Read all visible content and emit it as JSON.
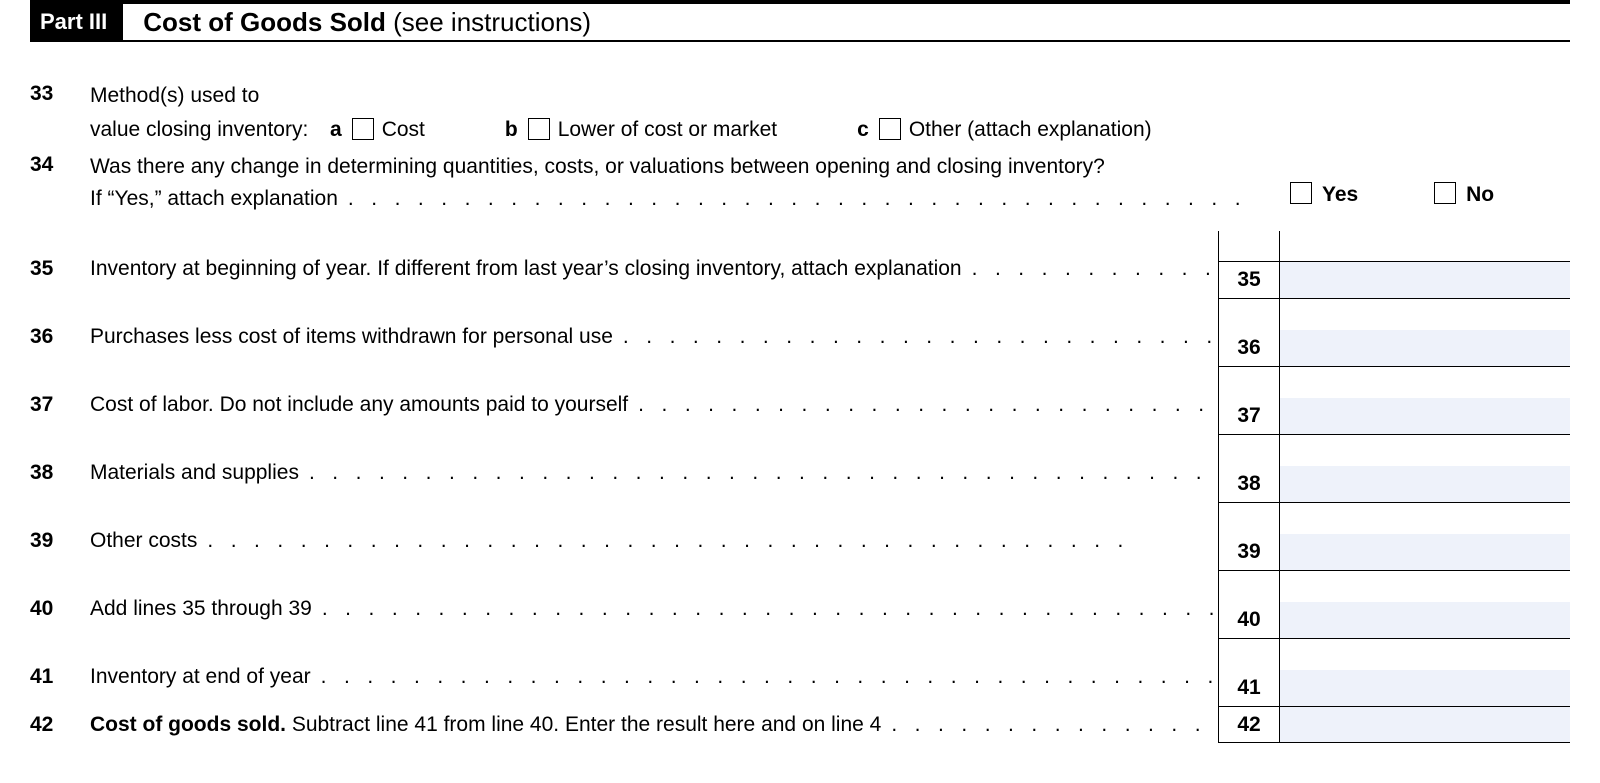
{
  "header": {
    "part": "Part III",
    "title_bold": "Cost of Goods Sold",
    "title_rest": " (see instructions)"
  },
  "line33": {
    "num": "33",
    "text1": "Method(s) used to",
    "text2": "value closing inventory:",
    "opts": {
      "a_label": "a",
      "a_text": "Cost",
      "b_label": "b",
      "b_text": "Lower of cost or market",
      "c_label": "c",
      "c_text": "Other (attach explanation)"
    }
  },
  "line34": {
    "num": "34",
    "text1": "Was there any change in determining quantities, costs, or valuations between opening and closing inventory?",
    "text2": "If “Yes,” attach explanation",
    "yes": "Yes",
    "no": "No"
  },
  "amount_lines": [
    {
      "num": "35",
      "box": "35",
      "text": "Inventory at beginning of year. If different from last year’s closing inventory, attach explanation",
      "bold": false,
      "value": ""
    },
    {
      "num": "36",
      "box": "36",
      "text": "Purchases less cost of items withdrawn for personal use",
      "bold": false,
      "value": ""
    },
    {
      "num": "37",
      "box": "37",
      "text": "Cost of labor. Do not include any amounts paid to yourself",
      "bold": false,
      "value": ""
    },
    {
      "num": "38",
      "box": "38",
      "text": "Materials and supplies",
      "bold": false,
      "value": ""
    },
    {
      "num": "39",
      "box": "39",
      "text": "Other costs",
      "bold": false,
      "value": ""
    },
    {
      "num": "40",
      "box": "40",
      "text": "Add lines 35 through 39",
      "bold": false,
      "value": ""
    },
    {
      "num": "41",
      "box": "41",
      "text": "Inventory at end of year",
      "bold": false,
      "value": ""
    },
    {
      "num": "42",
      "box": "42",
      "text_bold": "Cost of goods sold.",
      "text": " Subtract line 41 from line 40. Enter the result here and on line 4",
      "bold": true,
      "value": ""
    }
  ]
}
